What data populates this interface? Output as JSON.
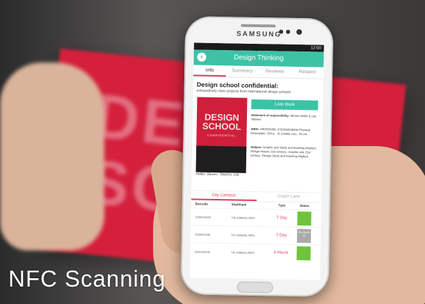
{
  "phone": {
    "brand": "SAMSUNG",
    "time": "12:00"
  },
  "app": {
    "title": "Design Thinking",
    "tabs": [
      "Info",
      "Summary",
      "Reviews",
      "Related"
    ],
    "book_title": "Design school confidential:",
    "book_subtitle": "extraordinary class projects from international design schools",
    "cover_title": "DESIGN SCHOOL",
    "cover_subtitle": "CONFIDENTIAL",
    "cover_caption": "Heller, Steven; Talarico, Lita",
    "loan_button": "Loan Book",
    "statement_label": "Statement of responsibility:",
    "statement_value": "Steven Heller & Lita Talarico",
    "isbn_label": "ISBN:",
    "isbn_value": "1592535496, 9781592535484 Physical Description: 204 p. : ill. (chiefly col.) ; 26 cm.",
    "subject_label": "Subject:",
    "subject_value": "Graphic arts Study and teaching (Higher); Design History 21st century.; Graphic arts 21st century.; Design Study and teaching (Higher)",
    "location_tabs": [
      "City Campus",
      "Coach Lane"
    ],
    "table_headers": [
      "Barcode",
      "Shelfmark",
      "Type",
      "Status"
    ],
    "rows": [
      {
        "barcode": "2008443208",
        "shelfmark": "745.4088HEL/REN",
        "type": "7 Day",
        "status": "available"
      },
      {
        "barcode": "2008443208",
        "shelfmark": "745.4088HEL/REN",
        "type": "7 Day",
        "status": "Due back 23"
      },
      {
        "barcode": "2008443208",
        "shelfmark": "745.4088HEL/REN",
        "type": "4 Hours",
        "status": "available"
      }
    ]
  },
  "overlay": {
    "caption": "NFC Scanning"
  },
  "colors": {
    "accent": "#3cc3a6",
    "highlight": "#e23a5d",
    "available": "#6fc43c"
  }
}
